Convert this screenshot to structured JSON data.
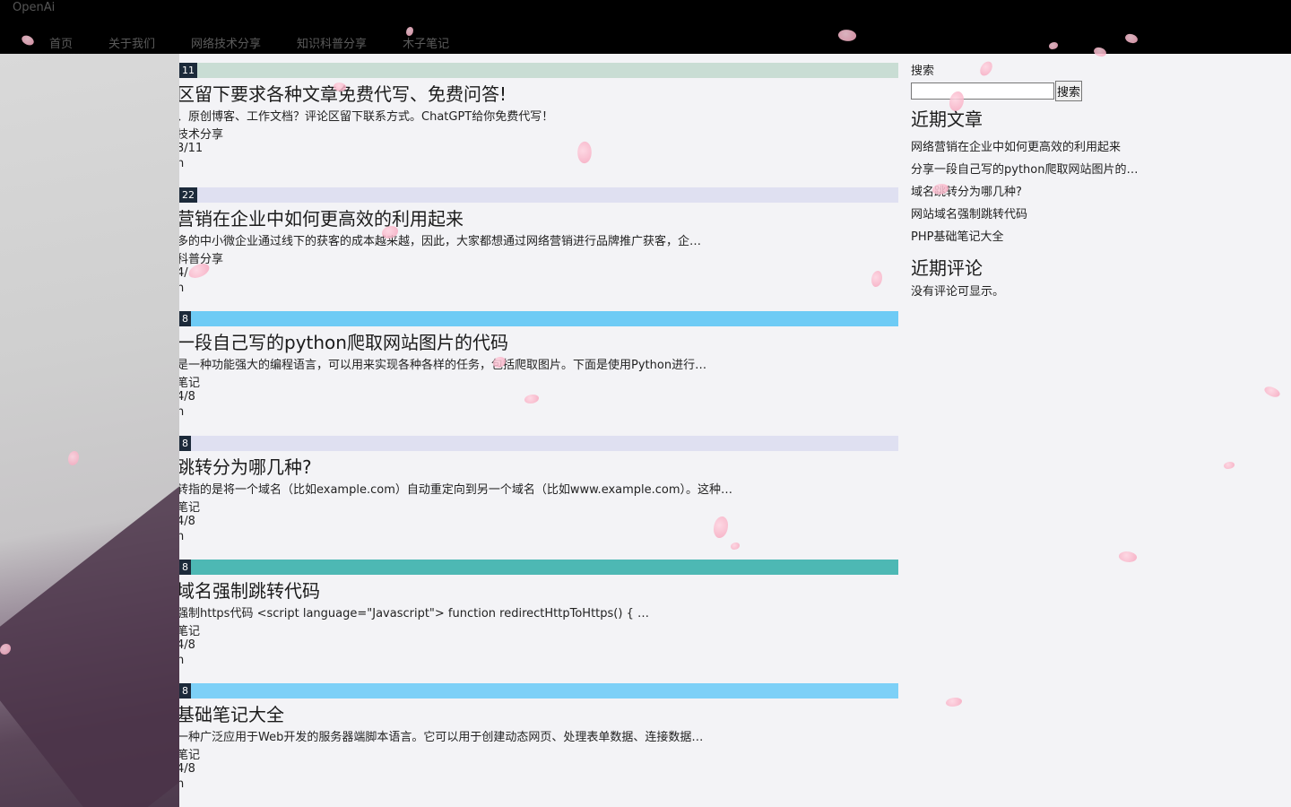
{
  "header": {
    "brand": "OpenAi",
    "nav": [
      "首页",
      "关于我们",
      "网络技术分享",
      "知识科普分享",
      "木子笔记"
    ]
  },
  "posts": [
    {
      "badge": "11",
      "bar_color": "#c9ddd4",
      "title": "区留下要求各种文章免费代写、免费问答!",
      "excerpt": "、原创博客、工作文档？评论区留下联系方式。ChatGPT给你免费代写！",
      "category": "技术分享",
      "date": "3/11",
      "more": "n"
    },
    {
      "badge": "22",
      "bar_color": "#dfe0f1",
      "title": "营销在企业中如何更高效的利用起来",
      "excerpt": "多的中小微企业通过线下的获客的成本越来越，因此，大家都想通过网络营销进行品牌推广获客，企…",
      "category": "科普分享",
      "date": "4/",
      "more": "n"
    },
    {
      "badge": "8",
      "bar_color": "#6ecbf5",
      "title": "一段自己写的python爬取网站图片的代码",
      "excerpt": "是一种功能强大的编程语言，可以用来实现各种各样的任务，包括爬取图片。下面是使用Python进行…",
      "category": "笔记",
      "date": "4/8",
      "more": "n"
    },
    {
      "badge": "8",
      "bar_color": "#dfe0f1",
      "title": "跳转分为哪几种?",
      "excerpt": "转指的是将一个域名（比如example.com）自动重定向到另一个域名（比如www.example.com）。这种…",
      "category": "笔记",
      "date": "4/8",
      "more": "n"
    },
    {
      "badge": "8",
      "bar_color": "#4db8b4",
      "title": "域名强制跳转代码",
      "excerpt": "强制https代码 <script language=\"Javascript\"> function redirectHttpToHttps() { …",
      "category": "笔记",
      "date": "4/8",
      "more": "n"
    },
    {
      "badge": "8",
      "bar_color": "#7dd0f7",
      "title": "基础笔记大全",
      "excerpt": "一种广泛应用于Web开发的服务器端脚本语言。它可以用于创建动态网页、处理表单数据、连接数据…",
      "category": "笔记",
      "date": "4/8",
      "more": "n"
    }
  ],
  "sidebar": {
    "search_label": "搜索",
    "search_value": "",
    "search_button": "搜索",
    "recent_posts_heading": "近期文章",
    "recent_posts": [
      "网络营销在企业中如何更高效的利用起来",
      "分享一段自己写的python爬取网站图片的…",
      "域名跳转分为哪几种?",
      "网站域名强制跳转代码",
      "PHP基础笔记大全"
    ],
    "recent_comments_heading": "近期评论",
    "no_comments": "没有评论可显示。"
  }
}
